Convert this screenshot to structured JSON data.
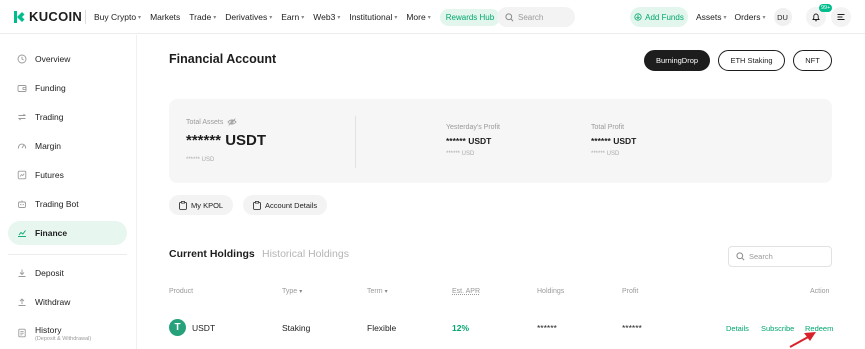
{
  "brand": {
    "name": "KUCOIN",
    "color": "#01bc8d"
  },
  "nav": {
    "items": [
      {
        "label": "Buy Crypto",
        "caret": true
      },
      {
        "label": "Markets",
        "caret": false
      },
      {
        "label": "Trade",
        "caret": true
      },
      {
        "label": "Derivatives",
        "caret": true
      },
      {
        "label": "Earn",
        "caret": true
      },
      {
        "label": "Web3",
        "caret": true
      },
      {
        "label": "Institutional",
        "caret": true
      },
      {
        "label": "More",
        "caret": true
      }
    ],
    "rewards_hub": "Rewards Hub",
    "search_placeholder": "Search",
    "add_funds": "Add Funds",
    "assets": "Assets",
    "orders": "Orders",
    "avatar": "DU",
    "notification_badge": "99+"
  },
  "sidebar": {
    "items": [
      {
        "label": "Overview",
        "icon": "clock-icon"
      },
      {
        "label": "Funding",
        "icon": "wallet-icon"
      },
      {
        "label": "Trading",
        "icon": "exchange-icon"
      },
      {
        "label": "Margin",
        "icon": "gauge-icon"
      },
      {
        "label": "Futures",
        "icon": "futures-icon"
      },
      {
        "label": "Trading Bot",
        "icon": "bot-icon"
      },
      {
        "label": "Finance",
        "icon": "finance-icon",
        "active": true
      }
    ],
    "items2": [
      {
        "label": "Deposit",
        "icon": "deposit-icon"
      },
      {
        "label": "Withdraw",
        "icon": "withdraw-icon"
      },
      {
        "label": "History",
        "icon": "history-icon",
        "sub": "(Deposit & Withdrawal)"
      }
    ]
  },
  "main": {
    "title": "Financial Account",
    "header_buttons": [
      "BurningDrop",
      "ETH Staking",
      "NFT"
    ],
    "total_assets": {
      "label": "Total Assets",
      "value": "****** USDT",
      "sub": "****** USD"
    },
    "yesterday_profit": {
      "label": "Yesterday's Profit",
      "value": "****** USDT",
      "sub": "****** USD"
    },
    "total_profit": {
      "label": "Total Profit",
      "value": "****** USDT",
      "sub": "****** USD"
    },
    "chips": [
      "My KPOL",
      "Account Details"
    ],
    "tabs": [
      "Current Holdings",
      "Historical Holdings"
    ],
    "table_search_placeholder": "Search",
    "columns": [
      "Product",
      "Type",
      "Term",
      "Est. APR",
      "Holdings",
      "Profit",
      "Action"
    ],
    "rows": [
      {
        "coin": "USDT",
        "coin_icon_letter": "T",
        "type": "Staking",
        "term": "Flexible",
        "apr": "12%",
        "holdings": "******",
        "profit": "******",
        "actions": [
          "Details",
          "Subscribe",
          "Redeem"
        ]
      }
    ]
  },
  "colors": {
    "accent": "#01a66c",
    "active_bg": "#e8f6f0",
    "arrow": "#d9212b"
  }
}
